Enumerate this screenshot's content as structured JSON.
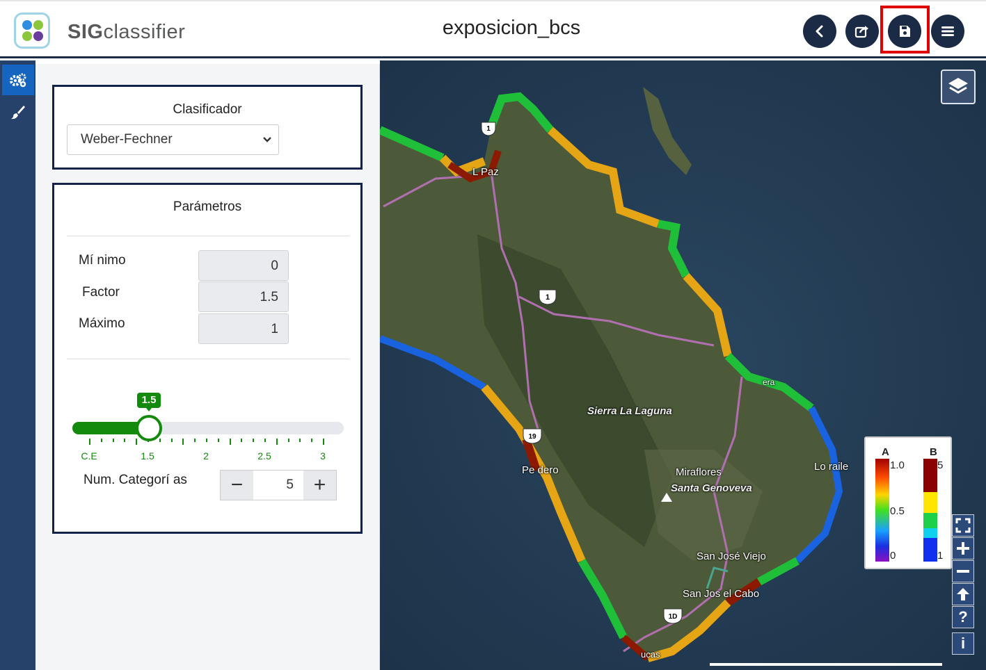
{
  "app": {
    "name_bold": "SIG",
    "name_rest": "classifier",
    "document_title": "exposicion_bcs"
  },
  "header_buttons": [
    {
      "name": "back-button",
      "icon": "chevron-left-icon"
    },
    {
      "name": "share-button",
      "icon": "share-icon"
    },
    {
      "name": "save-button",
      "icon": "save-icon"
    },
    {
      "name": "menu-button",
      "icon": "hamburger-icon"
    }
  ],
  "sidebar_tools": [
    {
      "icon": "gears-icon",
      "active": true
    },
    {
      "icon": "brush-icon",
      "active": false
    }
  ],
  "classifier": {
    "title": "Clasificador",
    "selected": "Weber-Fechner"
  },
  "parameters": {
    "title": "Parámetros",
    "minimum_label": "Mí nimo",
    "minimum_value": "0",
    "factor_label": "Factor",
    "factor_value": "1.5",
    "maximum_label": "Máximo",
    "maximum_value": "1",
    "slider": {
      "value": 1.5,
      "display": "1.5",
      "min": 1,
      "max": 3,
      "tick_labels": [
        "C.E",
        "1.5",
        "2",
        "2.5",
        "3"
      ]
    },
    "categories_label": "Num. Categorí as",
    "categories_value": "5",
    "minus": "−",
    "plus": "+"
  },
  "map": {
    "labels": {
      "la_paz": "L  Paz",
      "sierra": "Sierra La Laguna",
      "miraflores": "Miraflores",
      "santa_genoveva": "Santa Genoveva",
      "pescadero": "Pe   dero",
      "los_frailes": "Lo  raile",
      "san_jose_viejo": "San José Viejo",
      "san_jose_cabo": "San Jos    el Cabo",
      "ribera": "    era",
      "cabo": "   ucas"
    },
    "shields": {
      "h1_top": "1",
      "h1_mid": "1",
      "h19": "19",
      "h1d": "1D"
    },
    "legend": {
      "a_title": "A",
      "b_title": "B",
      "a_max": "1.0",
      "a_mid": "0.5",
      "a_min": "0",
      "b_max": "5",
      "b_min": "1"
    },
    "controls": [
      "fullscreen-icon",
      "zoom-in-icon",
      "zoom-out-icon",
      "north-arrow-icon",
      "help-icon",
      "info-icon"
    ],
    "control_glyphs": {
      "help": "?",
      "info": "i"
    }
  },
  "colors": {
    "navy": "#1b2a45",
    "green": "#138a0c",
    "highlight": "#e00000"
  }
}
